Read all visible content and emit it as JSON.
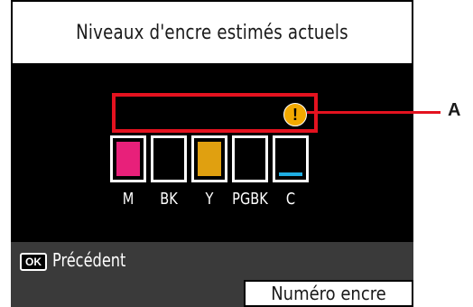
{
  "screen": {
    "title": "Niveaux d'encre estimés actuels",
    "status_icon": "warning-icon"
  },
  "ink_tanks": [
    {
      "label": "M",
      "color": "#e8207a",
      "level": 1.0
    },
    {
      "label": "BK",
      "color": "#000000",
      "level": 1.0
    },
    {
      "label": "Y",
      "color": "#e0a010",
      "level": 1.0
    },
    {
      "label": "PGBK",
      "color": "#000000",
      "level": 1.0
    },
    {
      "label": "C",
      "color": "#1faee3",
      "level": 0.1
    }
  ],
  "footer": {
    "ok_key": "OK",
    "back_label": "Précédent",
    "ink_number_button": "Numéro encre"
  },
  "callout": {
    "label": "A",
    "color": "#e4121f"
  }
}
